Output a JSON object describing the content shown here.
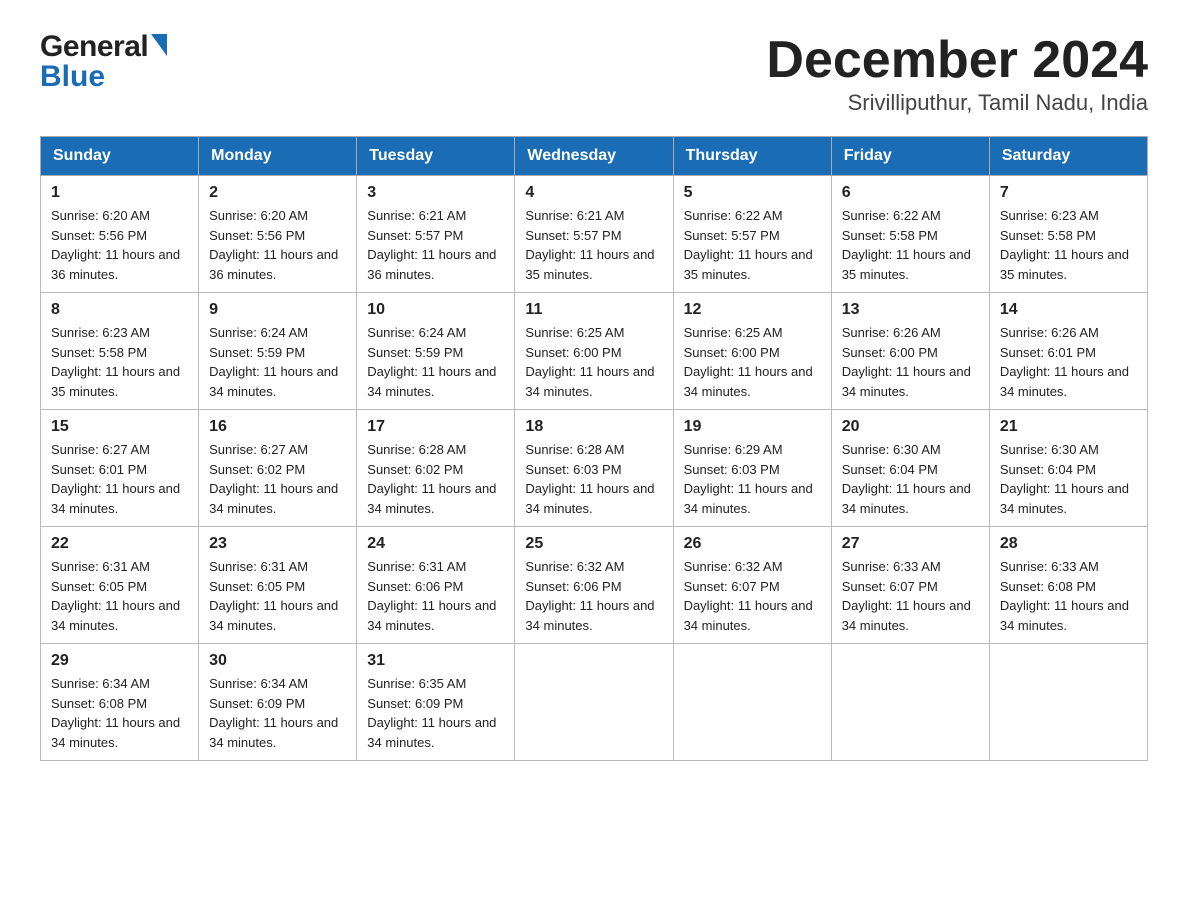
{
  "header": {
    "logo_general": "General",
    "logo_blue": "Blue",
    "title": "December 2024",
    "subtitle": "Srivilliputhur, Tamil Nadu, India"
  },
  "days_of_week": [
    "Sunday",
    "Monday",
    "Tuesday",
    "Wednesday",
    "Thursday",
    "Friday",
    "Saturday"
  ],
  "weeks": [
    [
      {
        "day": "1",
        "sunrise": "6:20 AM",
        "sunset": "5:56 PM",
        "daylight": "11 hours and 36 minutes."
      },
      {
        "day": "2",
        "sunrise": "6:20 AM",
        "sunset": "5:56 PM",
        "daylight": "11 hours and 36 minutes."
      },
      {
        "day": "3",
        "sunrise": "6:21 AM",
        "sunset": "5:57 PM",
        "daylight": "11 hours and 36 minutes."
      },
      {
        "day": "4",
        "sunrise": "6:21 AM",
        "sunset": "5:57 PM",
        "daylight": "11 hours and 35 minutes."
      },
      {
        "day": "5",
        "sunrise": "6:22 AM",
        "sunset": "5:57 PM",
        "daylight": "11 hours and 35 minutes."
      },
      {
        "day": "6",
        "sunrise": "6:22 AM",
        "sunset": "5:58 PM",
        "daylight": "11 hours and 35 minutes."
      },
      {
        "day": "7",
        "sunrise": "6:23 AM",
        "sunset": "5:58 PM",
        "daylight": "11 hours and 35 minutes."
      }
    ],
    [
      {
        "day": "8",
        "sunrise": "6:23 AM",
        "sunset": "5:58 PM",
        "daylight": "11 hours and 35 minutes."
      },
      {
        "day": "9",
        "sunrise": "6:24 AM",
        "sunset": "5:59 PM",
        "daylight": "11 hours and 34 minutes."
      },
      {
        "day": "10",
        "sunrise": "6:24 AM",
        "sunset": "5:59 PM",
        "daylight": "11 hours and 34 minutes."
      },
      {
        "day": "11",
        "sunrise": "6:25 AM",
        "sunset": "6:00 PM",
        "daylight": "11 hours and 34 minutes."
      },
      {
        "day": "12",
        "sunrise": "6:25 AM",
        "sunset": "6:00 PM",
        "daylight": "11 hours and 34 minutes."
      },
      {
        "day": "13",
        "sunrise": "6:26 AM",
        "sunset": "6:00 PM",
        "daylight": "11 hours and 34 minutes."
      },
      {
        "day": "14",
        "sunrise": "6:26 AM",
        "sunset": "6:01 PM",
        "daylight": "11 hours and 34 minutes."
      }
    ],
    [
      {
        "day": "15",
        "sunrise": "6:27 AM",
        "sunset": "6:01 PM",
        "daylight": "11 hours and 34 minutes."
      },
      {
        "day": "16",
        "sunrise": "6:27 AM",
        "sunset": "6:02 PM",
        "daylight": "11 hours and 34 minutes."
      },
      {
        "day": "17",
        "sunrise": "6:28 AM",
        "sunset": "6:02 PM",
        "daylight": "11 hours and 34 minutes."
      },
      {
        "day": "18",
        "sunrise": "6:28 AM",
        "sunset": "6:03 PM",
        "daylight": "11 hours and 34 minutes."
      },
      {
        "day": "19",
        "sunrise": "6:29 AM",
        "sunset": "6:03 PM",
        "daylight": "11 hours and 34 minutes."
      },
      {
        "day": "20",
        "sunrise": "6:30 AM",
        "sunset": "6:04 PM",
        "daylight": "11 hours and 34 minutes."
      },
      {
        "day": "21",
        "sunrise": "6:30 AM",
        "sunset": "6:04 PM",
        "daylight": "11 hours and 34 minutes."
      }
    ],
    [
      {
        "day": "22",
        "sunrise": "6:31 AM",
        "sunset": "6:05 PM",
        "daylight": "11 hours and 34 minutes."
      },
      {
        "day": "23",
        "sunrise": "6:31 AM",
        "sunset": "6:05 PM",
        "daylight": "11 hours and 34 minutes."
      },
      {
        "day": "24",
        "sunrise": "6:31 AM",
        "sunset": "6:06 PM",
        "daylight": "11 hours and 34 minutes."
      },
      {
        "day": "25",
        "sunrise": "6:32 AM",
        "sunset": "6:06 PM",
        "daylight": "11 hours and 34 minutes."
      },
      {
        "day": "26",
        "sunrise": "6:32 AM",
        "sunset": "6:07 PM",
        "daylight": "11 hours and 34 minutes."
      },
      {
        "day": "27",
        "sunrise": "6:33 AM",
        "sunset": "6:07 PM",
        "daylight": "11 hours and 34 minutes."
      },
      {
        "day": "28",
        "sunrise": "6:33 AM",
        "sunset": "6:08 PM",
        "daylight": "11 hours and 34 minutes."
      }
    ],
    [
      {
        "day": "29",
        "sunrise": "6:34 AM",
        "sunset": "6:08 PM",
        "daylight": "11 hours and 34 minutes."
      },
      {
        "day": "30",
        "sunrise": "6:34 AM",
        "sunset": "6:09 PM",
        "daylight": "11 hours and 34 minutes."
      },
      {
        "day": "31",
        "sunrise": "6:35 AM",
        "sunset": "6:09 PM",
        "daylight": "11 hours and 34 minutes."
      },
      null,
      null,
      null,
      null
    ]
  ]
}
